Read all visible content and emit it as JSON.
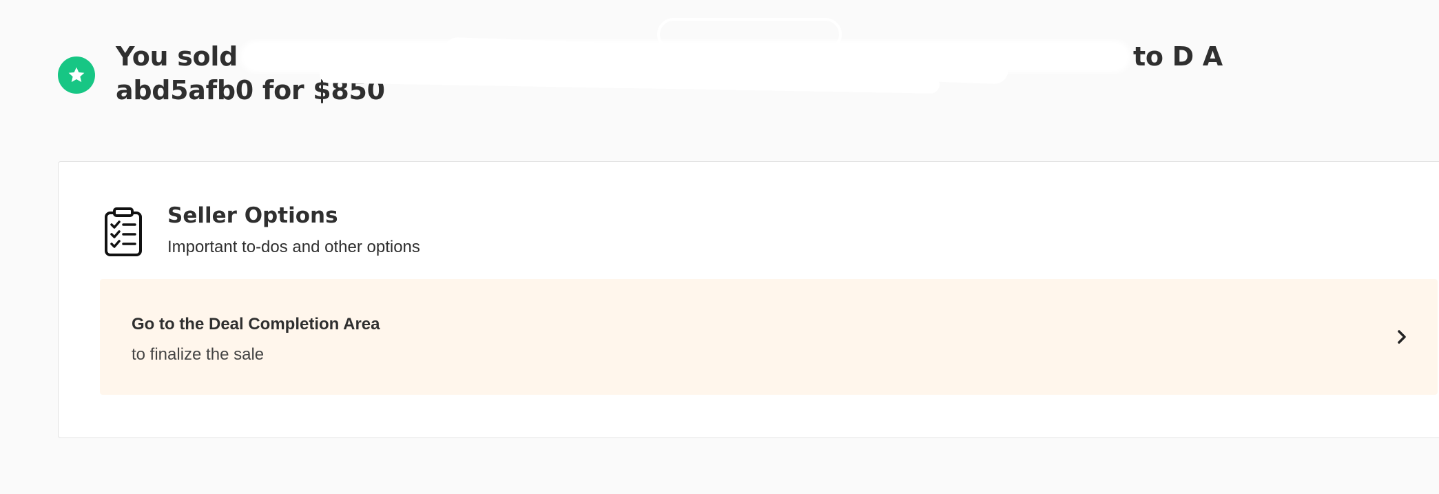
{
  "header": {
    "title_line1_start": "You sold",
    "title_line1_end": "to D A",
    "title_line2": "abd5afb0 for $850",
    "status_icon": "star-icon",
    "status_color": "#17c684"
  },
  "seller_options": {
    "icon": "clipboard-checklist-icon",
    "title": "Seller Options",
    "subtitle": "Important to-dos and other options"
  },
  "deal_completion": {
    "title": "Go to the Deal Completion Area",
    "subtitle": "to finalize the sale",
    "icon": "chevron-right-icon",
    "background": "#fff6ec"
  }
}
